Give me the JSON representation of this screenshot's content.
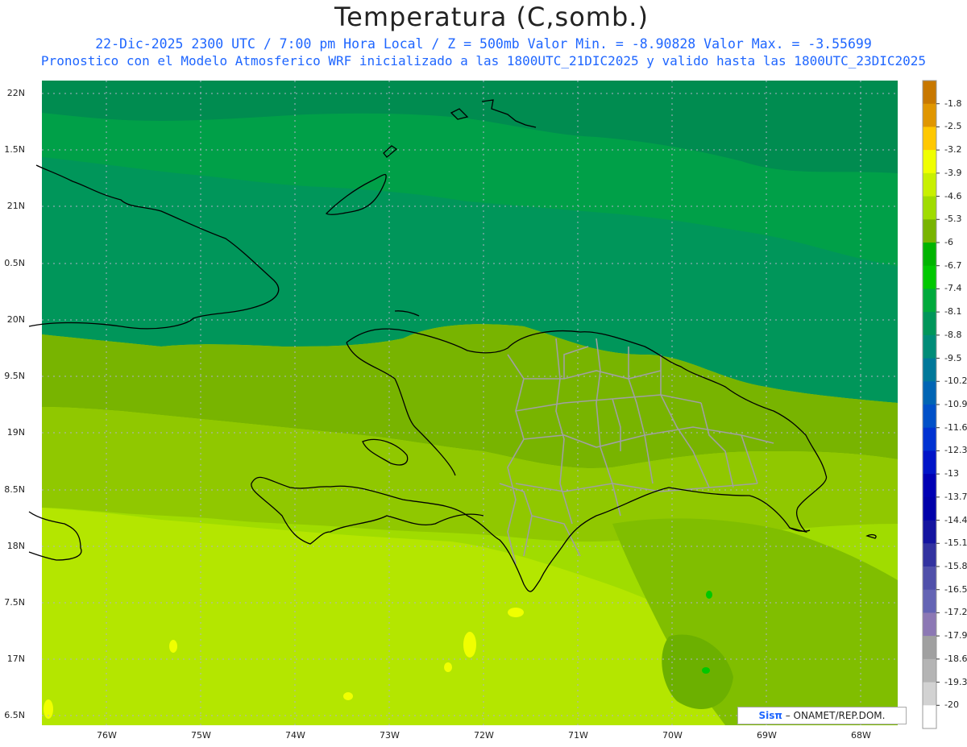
{
  "header": {
    "title": "Temperatura (C,somb.)",
    "subtitle1": "22-Dic-2025  2300 UTC / 7:00 pm Hora Local / Z = 500mb  Valor Min. = -8.90828  Valor Max. = -3.55699",
    "subtitle2": "Pronostico con el Modelo Atmosferico WRF inicializado a las 1800UTC_21DIC2025 y valido hasta las  1800UTC_23DIC2025"
  },
  "axes": {
    "lat_labels": [
      "22N",
      "1.5N",
      "21N",
      "0.5N",
      "20N",
      "9.5N",
      "19N",
      "8.5N",
      "18N",
      "7.5N",
      "17N",
      "6.5N"
    ],
    "lon_labels": [
      "76W",
      "75W",
      "74W",
      "73W",
      "72W",
      "71W",
      "70W",
      "69W",
      "68W"
    ]
  },
  "colorbar": {
    "labels": [
      "-1.8",
      "-2.5",
      "-3.2",
      "-3.9",
      "-4.6",
      "-5.3",
      "-6",
      "-6.7",
      "-7.4",
      "-8.1",
      "-8.8",
      "-9.5",
      "-10.2",
      "-10.9",
      "-11.6",
      "-12.3",
      "-13",
      "-13.7",
      "-14.4",
      "-15.1",
      "-15.8",
      "-16.5",
      "-17.2",
      "-17.9",
      "-18.6",
      "-19.3",
      "-20"
    ],
    "colors": [
      "#c87800",
      "#e09600",
      "#ffc800",
      "#f0ff00",
      "#c8f000",
      "#a0dc00",
      "#78b400",
      "#00b400",
      "#00c800",
      "#00aa3c",
      "#00965a",
      "#008c78",
      "#00789a",
      "#0064b4",
      "#0050c8",
      "#0032d2",
      "#0014c8",
      "#0000b4",
      "#0000aa",
      "#1414a0",
      "#3232a0",
      "#5050aa",
      "#6464b4",
      "#8c78b4",
      "#a0a0a0",
      "#b4b4b4",
      "#d2d2d2",
      "#ffffff"
    ]
  },
  "credit": {
    "brand": "Sisπ",
    "text": " – ONAMET/REP.DOM."
  }
}
